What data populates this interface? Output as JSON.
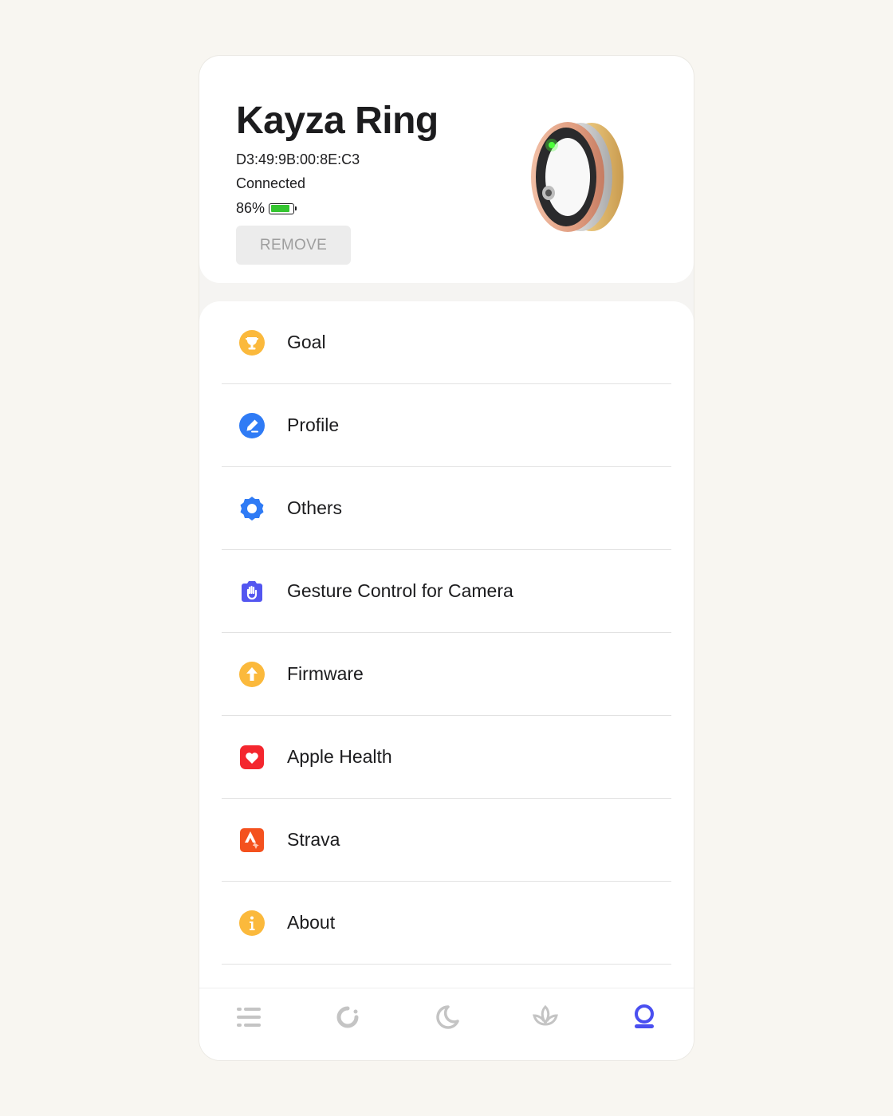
{
  "device": {
    "name": "Kayza Ring",
    "mac_address": "D3:49:9B:00:8E:C3",
    "status": "Connected",
    "battery_label": "86%",
    "battery_level": 0.86,
    "battery_color": "#35c530",
    "remove_label": "REMOVE"
  },
  "menu": {
    "items": [
      {
        "label": "Goal",
        "icon": "trophy-icon",
        "color": "#fbb93c"
      },
      {
        "label": "Profile",
        "icon": "edit-profile-icon",
        "color": "#2f7bf5"
      },
      {
        "label": "Others",
        "icon": "gear-icon",
        "color": "#2f7bf5"
      },
      {
        "label": "Gesture Control for Camera",
        "icon": "hand-gesture-icon",
        "color": "#5356f0"
      },
      {
        "label": "Firmware",
        "icon": "upload-arrow-icon",
        "color": "#fbb93c"
      },
      {
        "label": "Apple Health",
        "icon": "heart-icon",
        "color": "#f4262e"
      },
      {
        "label": "Strava",
        "icon": "strava-icon",
        "color": "#f4511e"
      },
      {
        "label": "About",
        "icon": "info-icon",
        "color": "#fbb93c"
      }
    ]
  },
  "tabbar": {
    "tabs": [
      {
        "icon": "list-icon",
        "active": false
      },
      {
        "icon": "activity-ring-icon",
        "active": false
      },
      {
        "icon": "moon-icon",
        "active": false
      },
      {
        "icon": "lotus-icon",
        "active": false
      },
      {
        "icon": "ring-device-icon",
        "active": true
      }
    ],
    "active_color": "#4a4ff0",
    "inactive_color": "#c4c4c4"
  }
}
